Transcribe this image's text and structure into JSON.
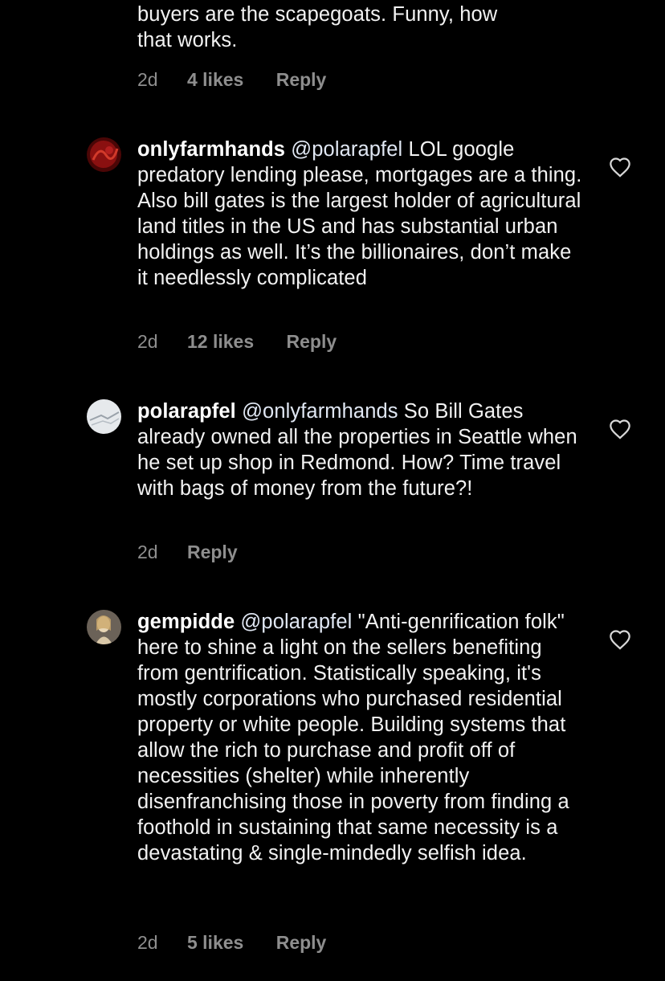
{
  "partial_comment": {
    "line1": "buyers are the scapegoats. Funny, how",
    "line2": "that works.",
    "time": "2d",
    "likes": "4 likes",
    "reply": "Reply"
  },
  "comments": [
    {
      "username": "onlyfarmhands",
      "mention": "@polarapfel",
      "text": " LOL google predatory lending please, mortgages are a thing. Also bill gates is the largest holder of agricultural land titles in the US and has substantial urban holdings as well. It’s the billionaires, don’t make it needlessly complicated",
      "time": "2d",
      "likes": "12 likes",
      "reply": "Reply",
      "avatar_color": "#8a1010"
    },
    {
      "username": "polarapfel",
      "mention": "@onlyfarmhands",
      "text": " So Bill Gates already owned all the properties in Seattle when he set up shop in Redmond. How? Time travel with bags of money from the future?!",
      "time": "2d",
      "likes": "",
      "reply": "Reply",
      "avatar_color": "#d9dde0"
    },
    {
      "username": "gempidde",
      "mention": "@polarapfel",
      "text": " \"Anti-genrification folk\" here to shine a light on the sellers benefiting from gentrification. Statistically speaking, it's mostly corporations who purchased residential property or white people. Building systems that allow the rich to purchase and profit off of necessities (shelter) while inherently disenfranchising those in poverty from finding a foothold in sustaining that same necessity is a devastating & single-mindedly selfish idea.",
      "time": "2d",
      "likes": "5 likes",
      "reply": "Reply",
      "avatar_color": "#b8a68a"
    }
  ],
  "icons": {
    "like": "heart-outline-icon"
  },
  "colors": {
    "background": "#000000",
    "text": "#f2f2f2",
    "secondary": "#8e8e8e"
  }
}
